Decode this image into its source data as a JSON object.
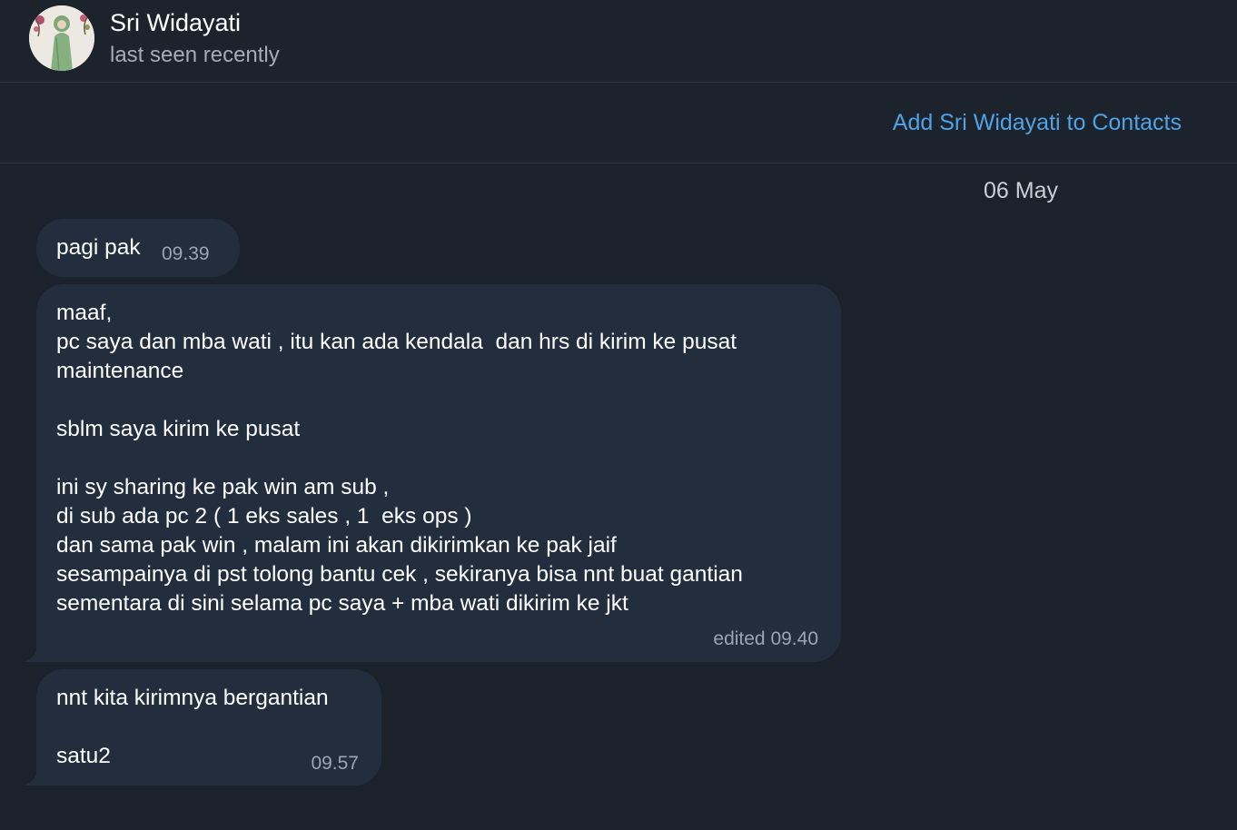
{
  "header": {
    "name": "Sri Widayati",
    "status": "last seen recently",
    "avatar": "profile-photo"
  },
  "add_bar": {
    "link_label": "Add Sri Widayati to Contacts",
    "link_color": "#4fa3e6"
  },
  "chat": {
    "date_label": "06 May",
    "messages": [
      {
        "text": "pagi pak",
        "time": "09.39"
      },
      {
        "text": "maaf,\npc saya dan mba wati , itu kan ada kendala  dan hrs di kirim ke pusat\nmaintenance\n\nsblm saya kirim ke pusat\n\nini sy sharing ke pak win am sub ,\ndi sub ada pc 2 ( 1 eks sales , 1  eks ops )\ndan sama pak win , malam ini akan dikirimkan ke pak jaif\nsesampainya di pst tolong bantu cek , sekiranya bisa nnt buat gantian\nsementara di sini selama pc saya + mba wati dikirim ke jkt",
        "time": "edited 09.40"
      },
      {
        "text": "nnt kita kirimnya bergantian\n\nsatu2",
        "time": "09.57"
      }
    ]
  },
  "colors": {
    "background": "#1b222b",
    "bubble": "#222e3d",
    "meta_text": "#9aa6b3"
  }
}
